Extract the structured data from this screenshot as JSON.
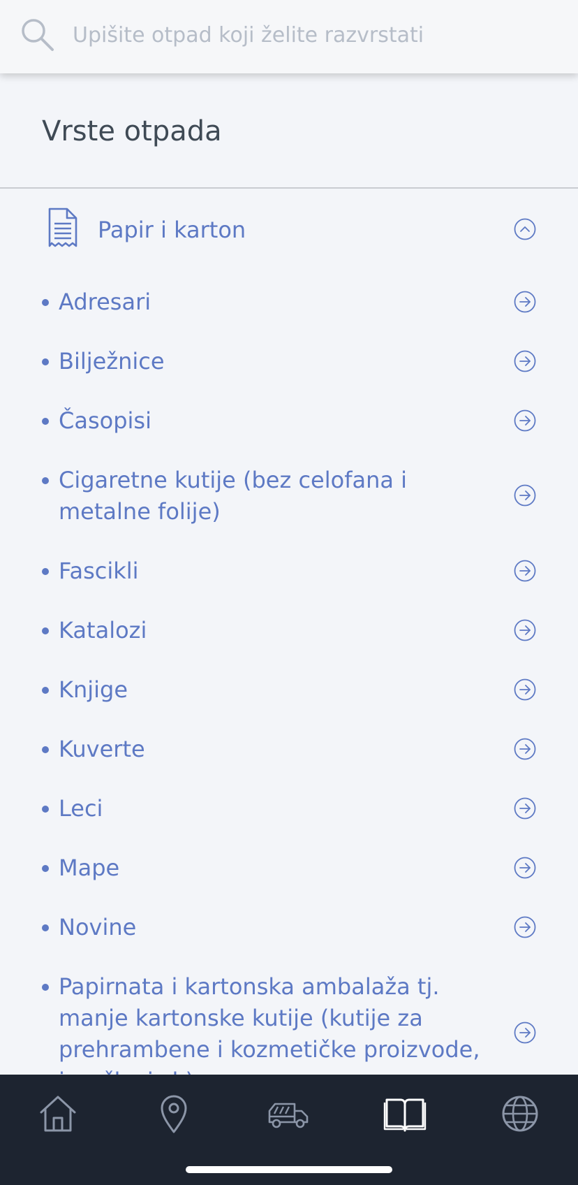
{
  "search": {
    "placeholder": "Upišite otpad koji želite razvrstati",
    "value": ""
  },
  "section": {
    "title": "Vrste otpada"
  },
  "category": {
    "label": "Papir i karton",
    "icon": "document-icon",
    "expanded": true
  },
  "items": [
    {
      "label": "Adresari"
    },
    {
      "label": "Bilježnice"
    },
    {
      "label": "Časopisi"
    },
    {
      "label": "Cigaretne kutije (bez celofana i metalne folije)"
    },
    {
      "label": "Fascikli"
    },
    {
      "label": "Katalozi"
    },
    {
      "label": "Knjige"
    },
    {
      "label": "Kuverte"
    },
    {
      "label": "Leci"
    },
    {
      "label": "Mape"
    },
    {
      "label": "Novine"
    },
    {
      "label": "Papirnata i kartonska ambalaža tj. manje kartonske kutije (kutije za prehrambene i kozmetičke proizvode, igračke i sl.)"
    }
  ],
  "bottom_nav": [
    {
      "icon": "home-icon"
    },
    {
      "icon": "location-pin-icon"
    },
    {
      "icon": "garbage-truck-icon"
    },
    {
      "icon": "book-icon",
      "active": true
    },
    {
      "icon": "globe-icon"
    }
  ],
  "colors": {
    "accent": "#5d79c4",
    "title": "#3f4a55",
    "background": "#f3f5f9",
    "nav_background": "#1d2430",
    "nav_active": "#ffffff",
    "nav_inactive": "#8c96a8"
  }
}
